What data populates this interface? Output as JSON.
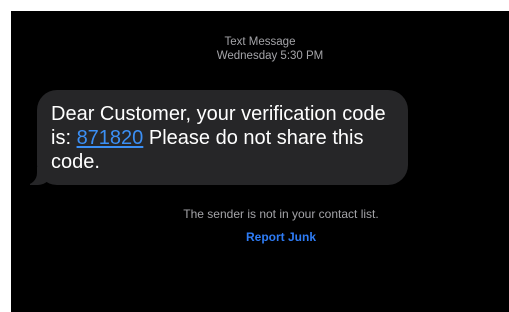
{
  "header": {
    "service_label": "Text Message",
    "timestamp": "Wednesday 5:30 PM"
  },
  "message": {
    "text_before_code": "Dear Customer, your verification code is: ",
    "code": "871820",
    "text_after_code": " Please do not share this code."
  },
  "footer": {
    "notice": "The sender is not in your contact list.",
    "report_junk": "Report Junk"
  },
  "colors": {
    "background": "#000000",
    "bubble": "#262628",
    "link": "#3b8ff5",
    "secondary_text": "#a4a4a8"
  }
}
